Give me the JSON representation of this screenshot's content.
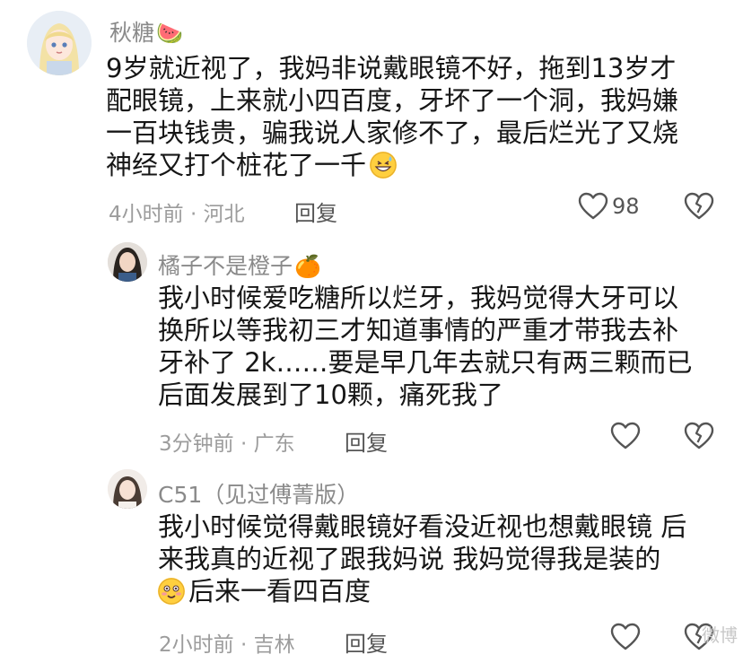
{
  "comments": [
    {
      "username": "秋糖",
      "user_emoji": "🍉",
      "lines": [
        "9岁就近视了，我妈非说戴眼镜不好，拖到13岁才",
        "配眼镜，上来就小四百度，牙坏了一个洞，我妈嫌",
        "一百块钱贵，骗我说人家修不了，最后烂光了又烧",
        "神经又打个桩花了一千"
      ],
      "end_emoji": "grinning-sweat-face",
      "time_location": "4小时前 · 河北",
      "reply_label": "回复",
      "like_count": "98"
    },
    {
      "username": "橘子不是橙子",
      "user_emoji": "🍊",
      "lines": [
        "我小时候爱吃糖所以烂牙，我妈觉得大牙可以",
        "换所以等我初三才知道事情的严重才带我去补",
        "牙补了 2k……要是早几年去就只有两三颗而已",
        "后面发展到了10颗，痛死我了"
      ],
      "time_location": "3分钟前 · 广东",
      "reply_label": "回复",
      "like_count": ""
    },
    {
      "username": "C51（见过傅菁版）",
      "lines": [
        "我小时候觉得戴眼镜好看没近视也想戴眼镜 后",
        "来我真的近视了跟我妈说 我妈觉得我是装的",
        "后来一看四百度"
      ],
      "start_emoji": "blushing-smile-face",
      "time_location": "2小时前 · 吉林",
      "reply_label": "回复",
      "like_count": ""
    }
  ],
  "watermark": "微博"
}
